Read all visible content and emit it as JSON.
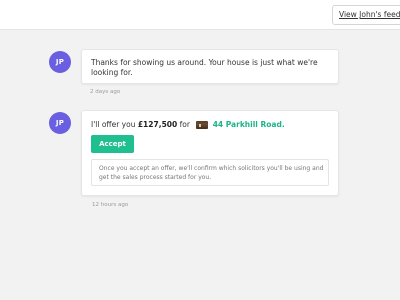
{
  "header": {
    "feedback_link": "View John's feedba"
  },
  "messages": [
    {
      "avatar_initials": "JP",
      "text": "Thanks for showing us around. Your house is just what we're looking for.",
      "timestamp": "2 days ago"
    },
    {
      "avatar_initials": "JP",
      "offer_prefix": "I'll offer you",
      "offer_amount": "£127,500",
      "offer_for": "for",
      "address": "44 Parkhill Road.",
      "accept_label": "Accept",
      "info_text": "Once you accept an offer, we'll confirm which solicitors you'll be using and get the sales process started for you.",
      "timestamp": "12 hours ago"
    }
  ],
  "colors": {
    "avatar": "#6a5fe0",
    "accent_green": "#1fbf8f",
    "address_green": "#1bb38a",
    "background": "#f2f2f2"
  }
}
